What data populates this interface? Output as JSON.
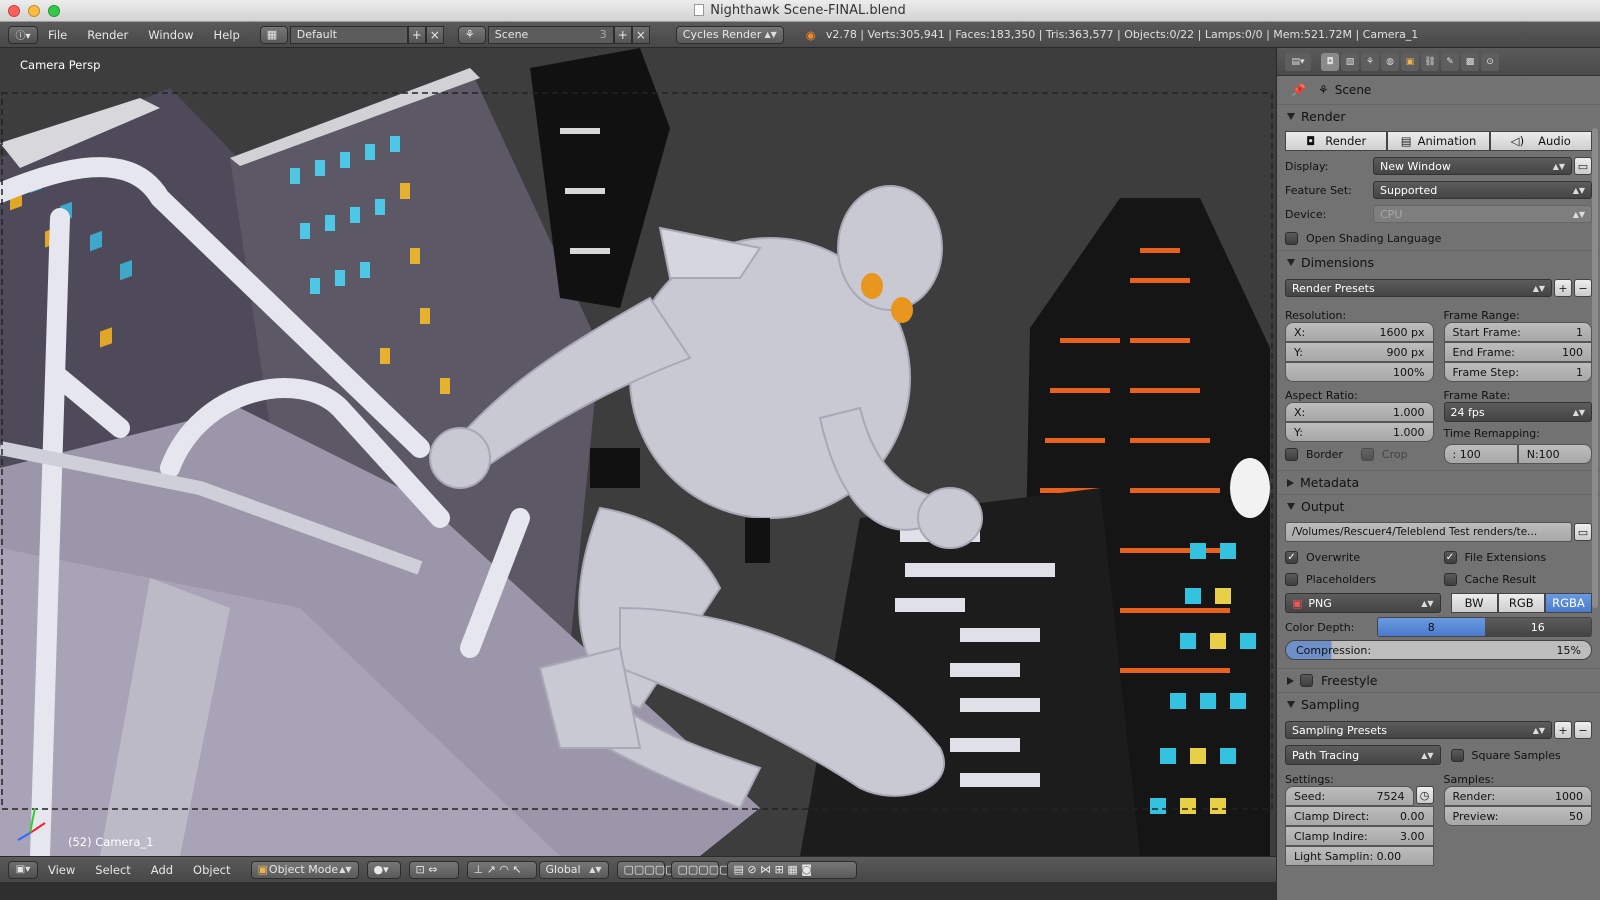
{
  "window": {
    "title": "Nighthawk Scene-FINAL.blend"
  },
  "menu": {
    "file": "File",
    "render": "Render",
    "window": "Window",
    "help": "Help"
  },
  "header": {
    "layout_value": "Default",
    "scene_value": "Scene",
    "scene_users": "3",
    "engine": "Cycles Render",
    "stats": "v2.78 | Verts:305,941 | Faces:183,350 | Tris:363,577 | Objects:0/22 | Lamps:0/0 | Mem:521.72M | Camera_1"
  },
  "viewport": {
    "view_label": "Camera Persp",
    "camera_label": "(52) Camera_1"
  },
  "bottom": {
    "view": "View",
    "select": "Select",
    "add": "Add",
    "object": "Object",
    "mode": "Object Mode",
    "orientation": "Global"
  },
  "props": {
    "breadcrumb": "Scene",
    "render": {
      "title": "Render",
      "btn_render": "Render",
      "btn_animation": "Animation",
      "btn_audio": "Audio",
      "display_label": "Display:",
      "display_value": "New Window",
      "feature_label": "Feature Set:",
      "feature_value": "Supported",
      "device_label": "Device:",
      "device_value": "CPU",
      "osl_label": "Open Shading Language"
    },
    "dimensions": {
      "title": "Dimensions",
      "presets": "Render Presets",
      "resolution_label": "Resolution:",
      "res_x_label": "X:",
      "res_x": "1600 px",
      "res_y_label": "Y:",
      "res_y": "900 px",
      "res_pct": "100%",
      "frame_range_label": "Frame Range:",
      "start_label": "Start Frame:",
      "start": "1",
      "end_label": "End Frame:",
      "end": "100",
      "step_label": "Frame Step:",
      "step": "1",
      "aspect_label": "Aspect Ratio:",
      "asp_x_label": "X:",
      "asp_x": "1.000",
      "asp_y_label": "Y:",
      "asp_y": "1.000",
      "framerate_label": "Frame Rate:",
      "framerate": "24 fps",
      "remap_label": "Time Remapping:",
      "remap_old": ": 100",
      "remap_new": "N:100",
      "border": "Border",
      "crop": "Crop"
    },
    "metadata": {
      "title": "Metadata"
    },
    "output": {
      "title": "Output",
      "path": "/Volumes/Rescuer4/Teleblend Test renders/te...",
      "overwrite": "Overwrite",
      "file_ext": "File Extensions",
      "placeholders": "Placeholders",
      "cache": "Cache Result",
      "format": "PNG",
      "bw": "BW",
      "rgb": "RGB",
      "rgba": "RGBA",
      "depth_label": "Color Depth:",
      "depth_8": "8",
      "depth_16": "16",
      "compression_label": "Compression:",
      "compression": "15%",
      "compression_fraction": 0.15
    },
    "freestyle": {
      "title": "Freestyle"
    },
    "sampling": {
      "title": "Sampling",
      "presets": "Sampling Presets",
      "integrator": "Path Tracing",
      "square": "Square Samples",
      "settings_label": "Settings:",
      "samples_label": "Samples:",
      "seed_label": "Seed:",
      "seed": "7524",
      "clamp_direct_label": "Clamp Direct:",
      "clamp_direct": "0.00",
      "clamp_indirect_label": "Clamp Indire:",
      "clamp_indirect": "3.00",
      "light_sampling": "Light Samplin: 0.00",
      "render_label": "Render:",
      "render_samples": "1000",
      "preview_label": "Preview:",
      "preview_samples": "50"
    }
  },
  "colors": {
    "active_blue": "#5a89d6",
    "panel_bg": "#727272",
    "header_bg": "#4f4f4f"
  }
}
